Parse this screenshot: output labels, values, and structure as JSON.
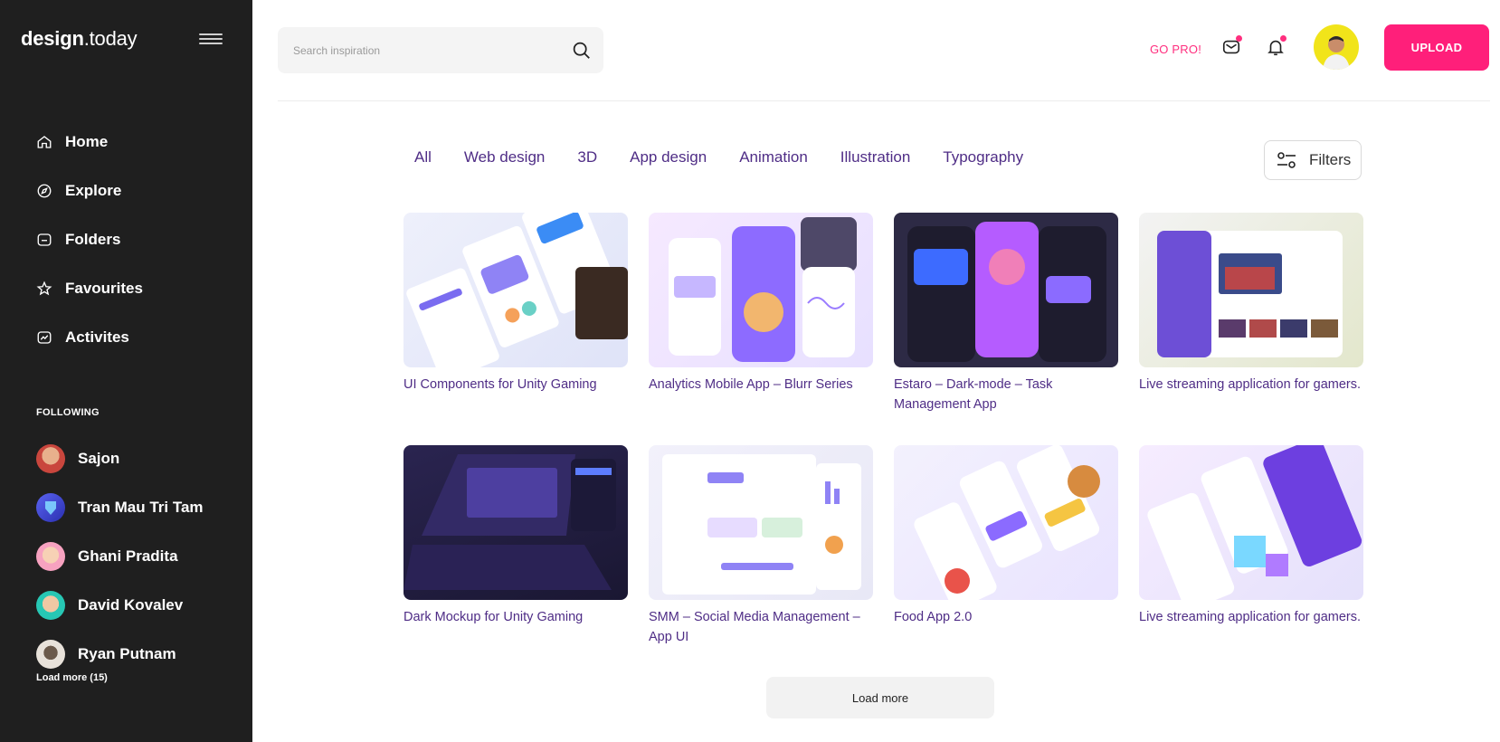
{
  "app": {
    "logo_bold": "design",
    "logo_rest": ".today"
  },
  "sidebar": {
    "nav": [
      {
        "label": "Home",
        "icon": "home-icon"
      },
      {
        "label": "Explore",
        "icon": "compass-icon"
      },
      {
        "label": "Folders",
        "icon": "folder-icon"
      },
      {
        "label": "Favourites",
        "icon": "star-icon"
      },
      {
        "label": "Activites",
        "icon": "activity-icon"
      }
    ],
    "following_title": "FOLLOWING",
    "following": [
      {
        "name": "Sajon",
        "color": "#c9463d"
      },
      {
        "name": "Tran Mau Tri Tam",
        "color": "#3a3fd4"
      },
      {
        "name": "Ghani Pradita",
        "color": "#f7a2c0"
      },
      {
        "name": "David Kovalev",
        "color": "#27c7b4"
      },
      {
        "name": "Ryan Putnam",
        "color": "#e8e2da"
      }
    ],
    "load_more": "Load more (15)"
  },
  "header": {
    "search_placeholder": "Search inspiration",
    "go_pro": "GO PRO!",
    "upload": "UPLOAD",
    "accent": "#ff1f7a"
  },
  "tabs": [
    "All",
    "Web design",
    "3D",
    "App design",
    "Animation",
    "Illustration",
    "Typography"
  ],
  "filters_label": "Filters",
  "cards": [
    {
      "title": "UI Components for Unity Gaming"
    },
    {
      "title": "Analytics Mobile App – Blurr Series"
    },
    {
      "title": "Estaro – Dark-mode – Task Management App"
    },
    {
      "title": "Live streaming application for gamers."
    },
    {
      "title": "Dark Mockup for Unity Gaming"
    },
    {
      "title": "SMM – Social Media Management – App UI"
    },
    {
      "title": "Food App 2.0"
    },
    {
      "title": "Live streaming application for gamers."
    }
  ],
  "load_more_main": "Load more"
}
